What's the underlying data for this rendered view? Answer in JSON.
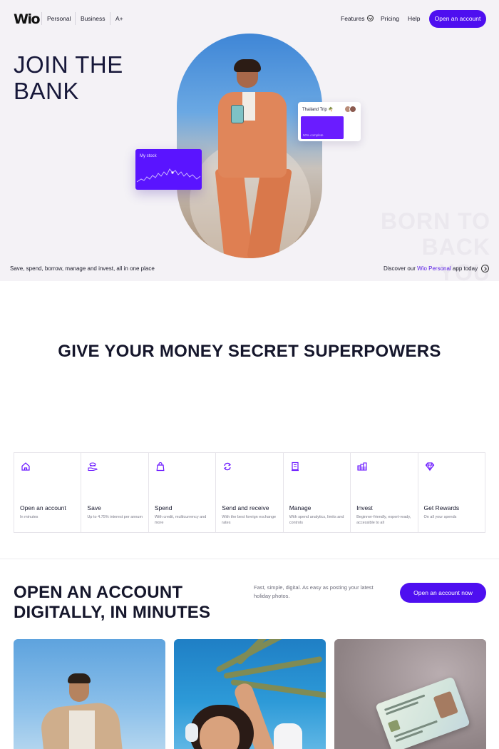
{
  "nav": {
    "logo": "Wio",
    "links": [
      "Personal",
      "Business",
      "A+"
    ],
    "features": "Features",
    "pricing": "Pricing",
    "help": "Help",
    "cta": "Open an account"
  },
  "hero": {
    "title": "JOIN THE BANK",
    "stock_card_label": "My stock",
    "trip_card_label": "Thailand Trip 🌴",
    "trip_card_progress": "50% complete",
    "ghost_text": "BORN TO BACK YOU",
    "tagline": "Save, spend, borrow, manage and invest, all in one place",
    "discover_prefix": "Discover our ",
    "discover_brand": "Wio Personal",
    "discover_suffix": " app today"
  },
  "powers": {
    "title": "GIVE YOUR MONEY SECRET SUPERPOWERS",
    "features": [
      {
        "icon": "home-icon",
        "title": "Open an account",
        "sub": "In minutes"
      },
      {
        "icon": "save-icon",
        "title": "Save",
        "sub": "Up to 4.75% interest per annum"
      },
      {
        "icon": "bag-icon",
        "title": "Spend",
        "sub": "With credit, multicurrency and more"
      },
      {
        "icon": "exchange-icon",
        "title": "Send and receive",
        "sub": "With the best foreign exchange rates"
      },
      {
        "icon": "receipt-icon",
        "title": "Manage",
        "sub": "With spend analytics, limits and controls"
      },
      {
        "icon": "coins-icon",
        "title": "Invest",
        "sub": "Beginner-friendly, expert-ready, accessible to all"
      },
      {
        "icon": "diamond-icon",
        "title": "Get Rewards",
        "sub": "On all your spends"
      }
    ]
  },
  "open_account": {
    "title": "OPEN AN ACCOUNT DIGITALLY, IN MINUTES",
    "description": "Fast, simple, digital. As easy as posting your latest holiday photos.",
    "cta": "Open an account now"
  },
  "colors": {
    "accent": "#4e0ff0",
    "hero_bg": "#f4f2f6",
    "text": "#15162b"
  }
}
